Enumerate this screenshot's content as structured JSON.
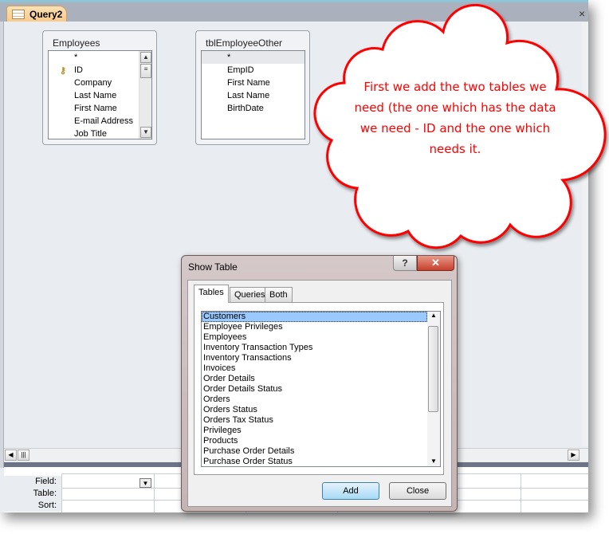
{
  "document_tab": {
    "label": "Query2",
    "close": "×"
  },
  "tables": [
    {
      "title": "Employees",
      "fields": [
        "*",
        "ID",
        "Company",
        "Last Name",
        "First Name",
        "E-mail Address",
        "Job Title"
      ],
      "primary_key": "ID"
    },
    {
      "title": "tblEmployeeOther",
      "fields": [
        "*",
        "EmpID",
        "First Name",
        "Last Name",
        "BirthDate"
      ]
    }
  ],
  "grid": {
    "row_labels": [
      "Field:",
      "Table:",
      "Sort:"
    ]
  },
  "callout": {
    "text": "First we add the two tables we need (the one which has the data we need - ID and the one which needs it.",
    "color": "#ff0000"
  },
  "dialog": {
    "title": "Show Table",
    "help": "?",
    "close": "✕",
    "tabs": [
      "Tables",
      "Queries",
      "Both"
    ],
    "active_tab": "Tables",
    "items": [
      "Customers",
      "Employee Privileges",
      "Employees",
      "Inventory Transaction Types",
      "Inventory Transactions",
      "Invoices",
      "Order Details",
      "Order Details Status",
      "Orders",
      "Orders Status",
      "Orders Tax Status",
      "Privileges",
      "Products",
      "Purchase Order Details",
      "Purchase Order Status"
    ],
    "selected": "Customers",
    "add_label": "Add",
    "close_label": "Close"
  }
}
